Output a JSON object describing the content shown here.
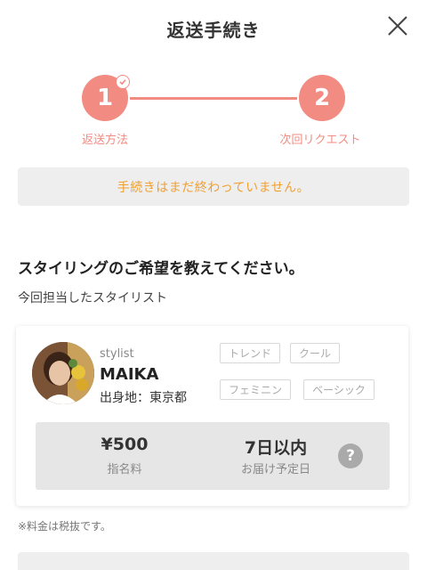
{
  "header": {
    "title": "返送手続き",
    "close_icon": "close-icon"
  },
  "stepper": {
    "steps": [
      {
        "number": "1",
        "label": "返送方法",
        "completed": true
      },
      {
        "number": "2",
        "label": "次回リクエスト",
        "completed": false
      }
    ],
    "accent_color": "#f28b82"
  },
  "notice": {
    "text": "手続きはまだ終わっていません。",
    "color": "#f0a030"
  },
  "section": {
    "heading": "スタイリングのご希望を教えてください。",
    "subheading": "今回担当したスタイリスト"
  },
  "stylist": {
    "role": "stylist",
    "name": "MAIKA",
    "origin": "出身地：東京都",
    "tags": [
      "トレンド",
      "クール",
      "フェミニン",
      "ベーシック"
    ],
    "price": "¥500",
    "price_label": "指名料",
    "delivery": "7日以内",
    "delivery_label": "お届け予定日",
    "help_icon": "question-icon"
  },
  "tax_note": "※料金は税抜です。"
}
